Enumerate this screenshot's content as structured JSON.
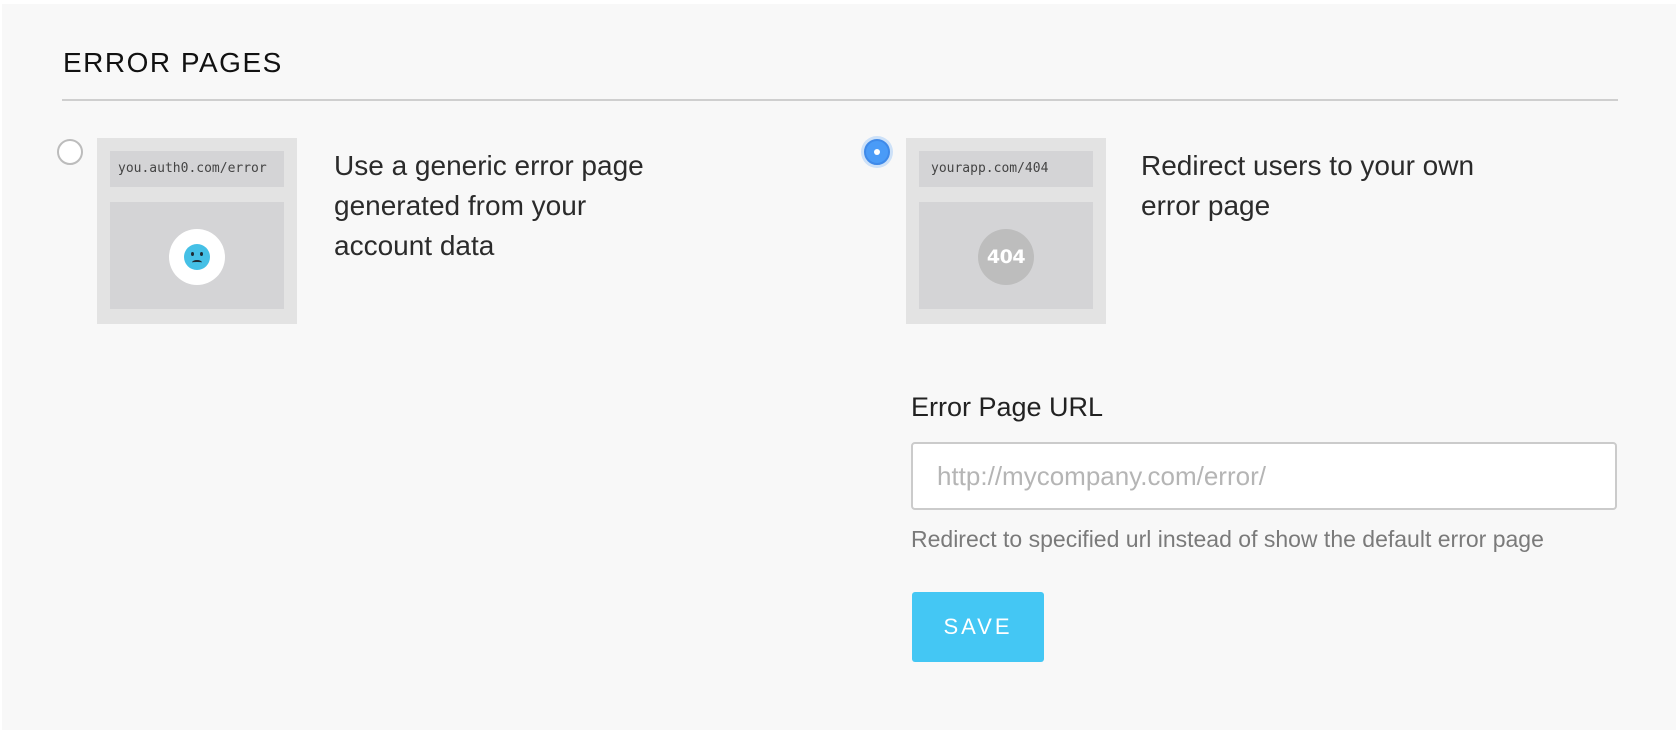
{
  "section": {
    "title": "ERROR PAGES"
  },
  "options": [
    {
      "selected": false,
      "preview_url": "you.auth0.com/error",
      "preview_icon": "sad-face-icon",
      "description_lines": [
        "Use a generic error page",
        "generated from your",
        "account data"
      ]
    },
    {
      "selected": true,
      "preview_url": "yourapp.com/404",
      "preview_badge": "404",
      "description_lines": [
        "Redirect users to your own",
        "error page"
      ]
    }
  ],
  "error_page_url": {
    "label": "Error Page URL",
    "value": "",
    "placeholder": "http://mycompany.com/error/",
    "help": "Redirect to specified url instead of show the default error page"
  },
  "save_label": "SAVE",
  "colors": {
    "radio_selected": "#4a9bf7",
    "save_button": "#44c7f4",
    "sad_face": "#45c0e6",
    "panel_background": "#f8f8f8"
  }
}
